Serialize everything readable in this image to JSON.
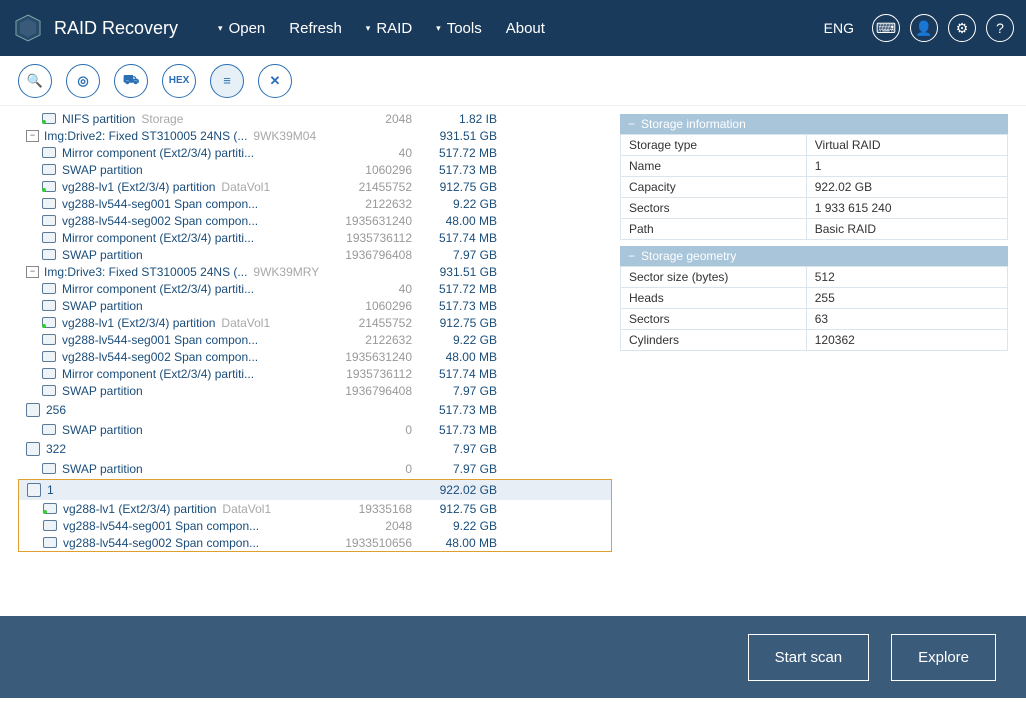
{
  "app": {
    "title": "RAID Recovery"
  },
  "menu": {
    "open": "Open",
    "refresh": "Refresh",
    "raid": "RAID",
    "tools": "Tools",
    "about": "About"
  },
  "header": {
    "lang": "ENG"
  },
  "toolbar": {
    "hex": "HEX"
  },
  "tree": {
    "r0": {
      "name": "NIFS partition",
      "meta": "Storage",
      "c2": "2048",
      "c3": "1.82 IB"
    },
    "r1": {
      "name": "Img:Drive2: Fixed ST310005 24NS (...",
      "meta": "9WK39M04",
      "c3": "931.51 GB"
    },
    "r2": {
      "name": "Mirror component (Ext2/3/4) partiti...",
      "c2": "40",
      "c3": "517.72 MB"
    },
    "r3": {
      "name": "SWAP partition",
      "c2": "1060296",
      "c3": "517.73 MB"
    },
    "r4": {
      "name": "vg288-lv1 (Ext2/3/4) partition",
      "meta": "DataVol1",
      "c2": "21455752",
      "c3": "912.75 GB"
    },
    "r5": {
      "name": "vg288-lv544-seg001 Span compon...",
      "c2": "2122632",
      "c3": "9.22 GB"
    },
    "r6": {
      "name": "vg288-lv544-seg002 Span compon...",
      "c2": "1935631240",
      "c3": "48.00 MB"
    },
    "r7": {
      "name": "Mirror component (Ext2/3/4) partiti...",
      "c2": "1935736112",
      "c3": "517.74 MB"
    },
    "r8": {
      "name": "SWAP partition",
      "c2": "1936796408",
      "c3": "7.97 GB"
    },
    "r9": {
      "name": "Img:Drive3: Fixed ST310005 24NS (...",
      "meta": "9WK39MRY",
      "c3": "931.51 GB"
    },
    "r10": {
      "name": "Mirror component (Ext2/3/4) partiti...",
      "c2": "40",
      "c3": "517.72 MB"
    },
    "r11": {
      "name": "SWAP partition",
      "c2": "1060296",
      "c3": "517.73 MB"
    },
    "r12": {
      "name": "vg288-lv1 (Ext2/3/4) partition",
      "meta": "DataVol1",
      "c2": "21455752",
      "c3": "912.75 GB"
    },
    "r13": {
      "name": "vg288-lv544-seg001 Span compon...",
      "c2": "2122632",
      "c3": "9.22 GB"
    },
    "r14": {
      "name": "vg288-lv544-seg002 Span compon...",
      "c2": "1935631240",
      "c3": "48.00 MB"
    },
    "r15": {
      "name": "Mirror component (Ext2/3/4) partiti...",
      "c2": "1935736112",
      "c3": "517.74 MB"
    },
    "r16": {
      "name": "SWAP partition",
      "c2": "1936796408",
      "c3": "7.97 GB"
    },
    "r17": {
      "name": "256",
      "c3": "517.73 MB"
    },
    "r18": {
      "name": "SWAP partition",
      "c2": "0",
      "c3": "517.73 MB"
    },
    "r19": {
      "name": "322",
      "c3": "7.97 GB"
    },
    "r20": {
      "name": "SWAP partition",
      "c2": "0",
      "c3": "7.97 GB"
    },
    "r21": {
      "name": "1",
      "c3": "922.02 GB"
    },
    "r22": {
      "name": "vg288-lv1 (Ext2/3/4) partition",
      "meta": "DataVol1",
      "c2": "19335168",
      "c3": "912.75 GB"
    },
    "r23": {
      "name": "vg288-lv544-seg001 Span compon...",
      "c2": "2048",
      "c3": "9.22 GB"
    },
    "r24": {
      "name": "vg288-lv544-seg002 Span compon...",
      "c2": "1933510656",
      "c3": "48.00 MB"
    }
  },
  "info": {
    "storage_hdr": "Storage information",
    "geom_hdr": "Storage geometry",
    "storage": {
      "type_k": "Storage type",
      "type_v": "Virtual RAID",
      "name_k": "Name",
      "name_v": "1",
      "cap_k": "Capacity",
      "cap_v": "922.02 GB",
      "sec_k": "Sectors",
      "sec_v": "1 933 615 240",
      "path_k": "Path",
      "path_v": "Basic RAID"
    },
    "geom": {
      "ss_k": "Sector size (bytes)",
      "ss_v": "512",
      "h_k": "Heads",
      "h_v": "255",
      "s_k": "Sectors",
      "s_v": "63",
      "c_k": "Cylinders",
      "c_v": "120362"
    }
  },
  "footer": {
    "scan": "Start scan",
    "explore": "Explore"
  }
}
